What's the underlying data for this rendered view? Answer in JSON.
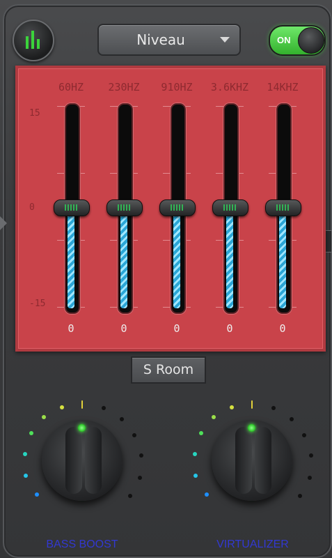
{
  "header": {
    "preset_label": "Niveau",
    "toggle_label": "ON"
  },
  "equalizer": {
    "scale_labels": [
      "15",
      "0",
      "-15"
    ],
    "bands": [
      {
        "freq": "60HZ",
        "gain": "0"
      },
      {
        "freq": "230HZ",
        "gain": "0"
      },
      {
        "freq": "910HZ",
        "gain": "0"
      },
      {
        "freq": "3.6KHZ",
        "gain": "0"
      },
      {
        "freq": "14KHZ",
        "gain": "0"
      }
    ]
  },
  "reverb": {
    "label": "S Room"
  },
  "knobs": [
    {
      "label": "BASS BOOST",
      "level": 0.5
    },
    {
      "label": "VIRTUALIZER",
      "level": 0.5
    }
  ],
  "colors": {
    "panel": "#c9434a",
    "toggle_on": "#33b12d",
    "led": "#26c020",
    "label_blue": "#3238d2"
  },
  "icons": [
    "equalizer-icon",
    "dropdown-caret-icon",
    "led-indicator-icon"
  ]
}
